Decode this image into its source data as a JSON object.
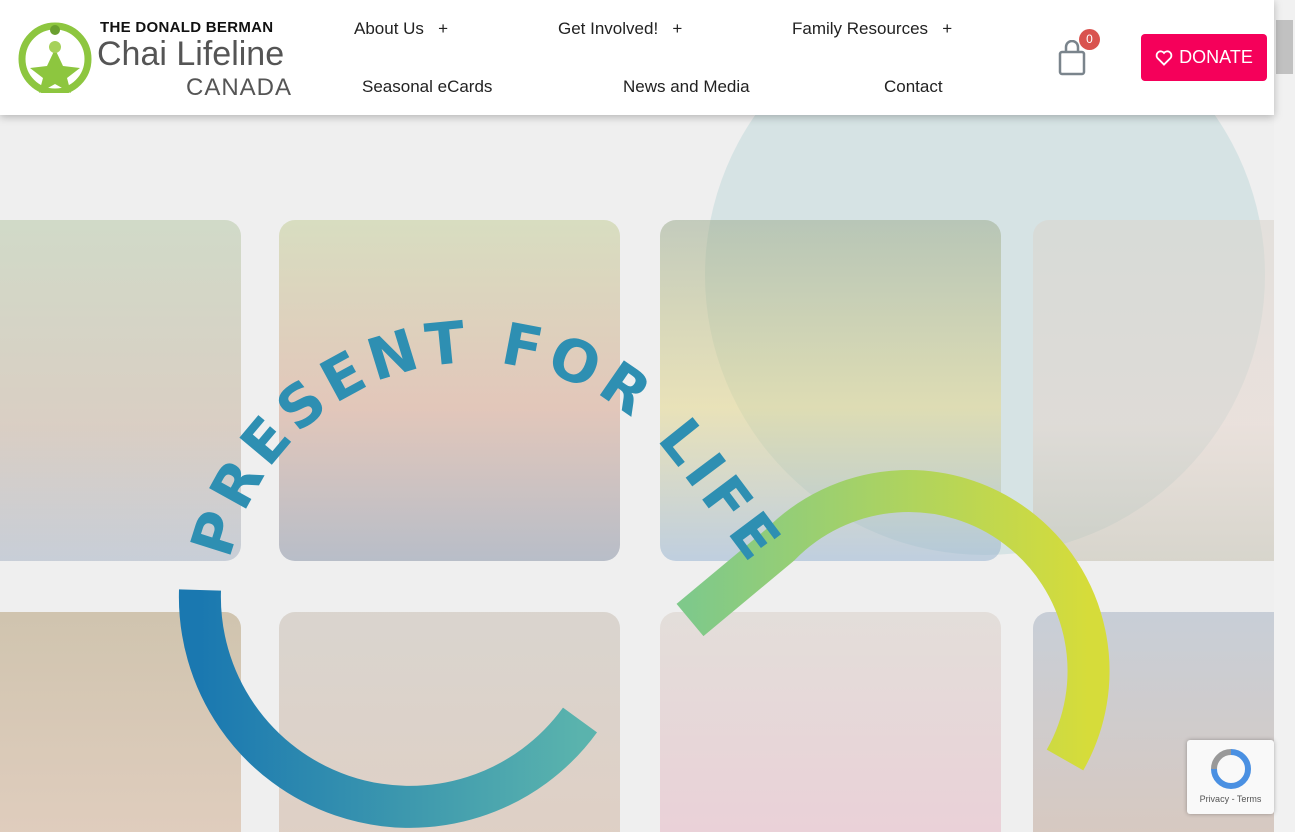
{
  "logo": {
    "line1": "THE DONALD BERMAN",
    "line2": "Chai Lifeline",
    "line3": "CANADA"
  },
  "nav": [
    {
      "label": "About Us",
      "plus": "+"
    },
    {
      "label": "Get Involved!",
      "plus": "+"
    },
    {
      "label": "Family Resources",
      "plus": "+"
    },
    {
      "label": "Seasonal eCards"
    },
    {
      "label": "News and Media"
    },
    {
      "label": "Contact"
    }
  ],
  "cart": {
    "count": "0",
    "icon": "shopping-bag-icon"
  },
  "donate": {
    "label": "DONATE",
    "icon": "heart-icon",
    "color": "#f5005a"
  },
  "hero": {
    "slogan": "PRESENT FOR LIFE"
  },
  "recaptcha": {
    "privacy": "Privacy",
    "terms": "Terms"
  }
}
